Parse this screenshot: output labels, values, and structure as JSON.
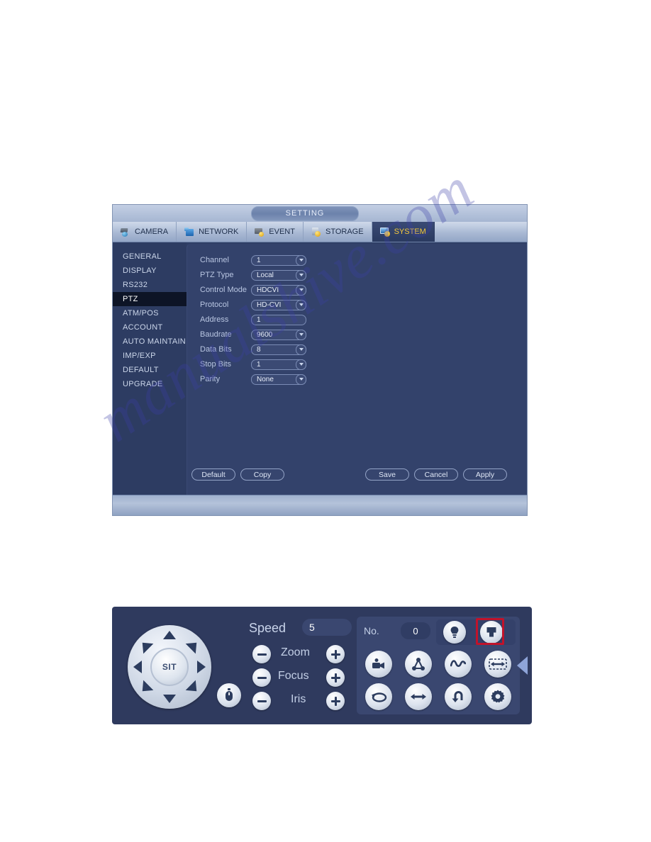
{
  "watermark": {
    "text": "manualshive.com"
  },
  "setting_window": {
    "title": "SETTING",
    "tabs": [
      {
        "label": "CAMERA",
        "icon": "camera-icon",
        "active": false
      },
      {
        "label": "NETWORK",
        "icon": "network-icon",
        "active": false
      },
      {
        "label": "EVENT",
        "icon": "event-icon",
        "active": false
      },
      {
        "label": "STORAGE",
        "icon": "storage-icon",
        "active": false
      },
      {
        "label": "SYSTEM",
        "icon": "system-icon",
        "active": true
      }
    ],
    "sidebar": {
      "items": [
        {
          "label": "GENERAL",
          "active": false
        },
        {
          "label": "DISPLAY",
          "active": false
        },
        {
          "label": "RS232",
          "active": false
        },
        {
          "label": "PTZ",
          "active": true
        },
        {
          "label": "ATM/POS",
          "active": false
        },
        {
          "label": "ACCOUNT",
          "active": false
        },
        {
          "label": "AUTO MAINTAIN",
          "active": false
        },
        {
          "label": "IMP/EXP",
          "active": false
        },
        {
          "label": "DEFAULT",
          "active": false
        },
        {
          "label": "UPGRADE",
          "active": false
        }
      ]
    },
    "form": {
      "fields": [
        {
          "label": "Channel",
          "value": "1",
          "dropdown": true
        },
        {
          "label": "PTZ Type",
          "value": "Local",
          "dropdown": true
        },
        {
          "label": "Control Mode",
          "value": "HDCVI",
          "dropdown": true
        },
        {
          "label": "Protocol",
          "value": "HD-CVI",
          "dropdown": true
        },
        {
          "label": "Address",
          "value": "1",
          "dropdown": false
        },
        {
          "label": "Baudrate",
          "value": "9600",
          "dropdown": true
        },
        {
          "label": "Data Bits",
          "value": "8",
          "dropdown": true
        },
        {
          "label": "Stop Bits",
          "value": "1",
          "dropdown": true
        },
        {
          "label": "Parity",
          "value": "None",
          "dropdown": true
        }
      ]
    },
    "buttons": {
      "default_label": "Default",
      "copy_label": "Copy",
      "save_label": "Save",
      "cancel_label": "Cancel",
      "apply_label": "Apply"
    },
    "colors": {
      "accent_active_tab_text": "#f5c93c",
      "window_body": "#2f3f66",
      "content_panel": "#33426b"
    }
  },
  "ptz_panel": {
    "dpad": {
      "center_label": "SIT",
      "directions": [
        "up",
        "up-right",
        "right",
        "down-right",
        "down",
        "down-left",
        "left",
        "up-left"
      ]
    },
    "mouse_button": {
      "icon": "mouse-icon"
    },
    "speed": {
      "label": "Speed",
      "value": "5"
    },
    "controls": [
      {
        "label": "Zoom",
        "minus": "−",
        "plus": "+"
      },
      {
        "label": "Focus",
        "minus": "−",
        "plus": "+"
      },
      {
        "label": "Iris",
        "minus": "−",
        "plus": "+"
      }
    ],
    "preset": {
      "label": "No.",
      "value": "0"
    },
    "top_icons": [
      {
        "name": "light-bulb-icon",
        "highlighted": false
      },
      {
        "name": "wiper-icon",
        "highlighted": true
      }
    ],
    "grid_icons": [
      {
        "name": "preset-camera-icon"
      },
      {
        "name": "tour-icon"
      },
      {
        "name": "pattern-icon"
      },
      {
        "name": "auto-scan-icon"
      },
      {
        "name": "rotate-icon"
      },
      {
        "name": "auto-pan-icon"
      },
      {
        "name": "reset-icon"
      },
      {
        "name": "settings-gear-icon"
      }
    ],
    "collapse_arrow": {
      "name": "collapse-left-arrow-icon"
    },
    "colors": {
      "panel_bg": "#2f3a5e",
      "group_bg": "#3a4770",
      "highlight_border": "#c0132b"
    }
  }
}
